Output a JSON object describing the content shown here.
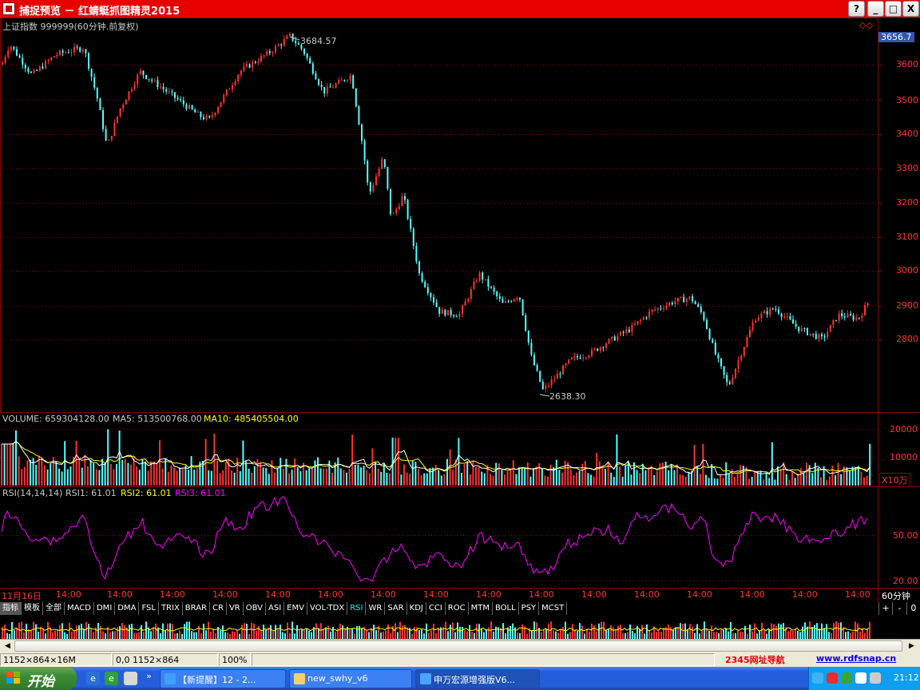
{
  "window": {
    "title": "捕捉预览 － 红蜻蜓抓图精灵2015",
    "buttons": {
      "help": "?",
      "minimize": "_",
      "maximize": "□",
      "close": "X"
    }
  },
  "chart": {
    "header": "上证指数 999999(60分钟.前复权)",
    "current_price": "3656.7",
    "high_marker": "3684.57",
    "low_marker": "2638.30",
    "price_axis": [
      "3600",
      "3500",
      "3400",
      "3300",
      "3200",
      "3100",
      "3000",
      "2900",
      "2800"
    ],
    "volume": {
      "label": "VOLUME: 659304128.00",
      "ma5": "MA5: 513500768.00",
      "ma10": "MA10: 485405504.00",
      "axis": [
        "20000",
        "10000"
      ],
      "unit": "X10万"
    },
    "rsi": {
      "label": "RSI(14,14,14)",
      "rsi1": "RSI1: 61.01",
      "rsi2": "RSI2: 61.01",
      "rsi3": "RSI3: 61.01",
      "axis": [
        "50.00",
        "20.00"
      ]
    },
    "time_axis": [
      "11月16日",
      "14:00",
      "14:00",
      "14:00",
      "14:00",
      "14:00",
      "14:00",
      "14:00",
      "14:00",
      "14:00",
      "14:00",
      "14:00",
      "14:00",
      "14:00",
      "14:00",
      "14:00",
      "14:00",
      "14:00"
    ],
    "period": "60分钟",
    "colors": {
      "up": "#ff3232",
      "down": "#54ffff",
      "grid": "#8b0000",
      "rsi": "#ff00ff",
      "ma5": "#ffffff",
      "ma10": "#ffff00"
    }
  },
  "indicator_tabs": [
    "指标",
    "模板",
    "全部",
    "MACD",
    "DMI",
    "DMA",
    "FSL",
    "TRIX",
    "BRAR",
    "CR",
    "VR",
    "OBV",
    "ASI",
    "EMV",
    "VOL-TDX",
    "RSI",
    "WR",
    "SAR",
    "KDJ",
    "CCI",
    "ROC",
    "MTM",
    "BOLL",
    "PSY",
    "MCST"
  ],
  "active_tab": "RSI",
  "zoom": {
    "plus": "+",
    "minus": "-",
    "zero": "0"
  },
  "statusbar": {
    "size": "1152×864×16M",
    "coords": "0,0 1152×864",
    "zoom": "100%",
    "nav_link": "2345网址导航",
    "site": "www.rdfsnap.cn"
  },
  "taskbar": {
    "start": "开始",
    "quicklaunch_more": "»",
    "buttons": [
      {
        "label": "【新提醒】12 - 2...",
        "icon": "browser-icon"
      },
      {
        "label": "new_swhy_v6",
        "icon": "folder-icon"
      },
      {
        "label": "申万宏源增强版V6...",
        "icon": "app-icon"
      }
    ],
    "clock": "21:12"
  }
}
